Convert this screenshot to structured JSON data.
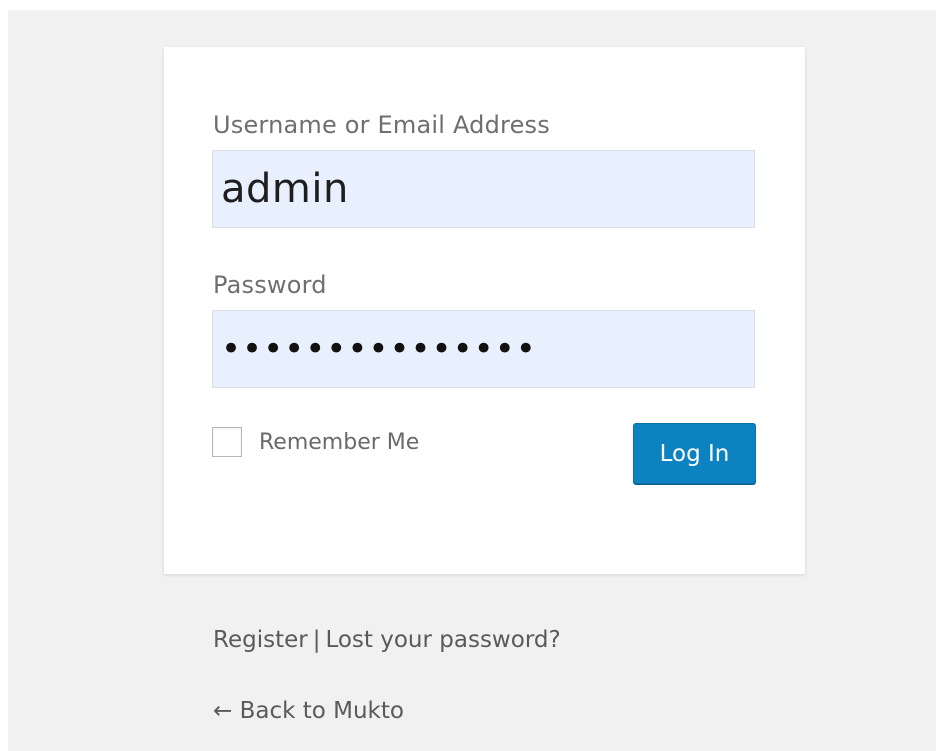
{
  "form": {
    "username_label": "Username or Email Address",
    "username_value": "admin",
    "password_label": "Password",
    "password_masked": "•••••••••••••••",
    "remember_label": "Remember Me",
    "remember_checked": false,
    "login_button": "Log In"
  },
  "links": {
    "register": "Register",
    "separator": "|",
    "lost_password": "Lost your password?",
    "back_to_site": "← Back to Mukto"
  },
  "colors": {
    "page_background": "#f1f1f1",
    "input_fill": "#e8f0fe",
    "primary_button": "#0d82c1"
  }
}
